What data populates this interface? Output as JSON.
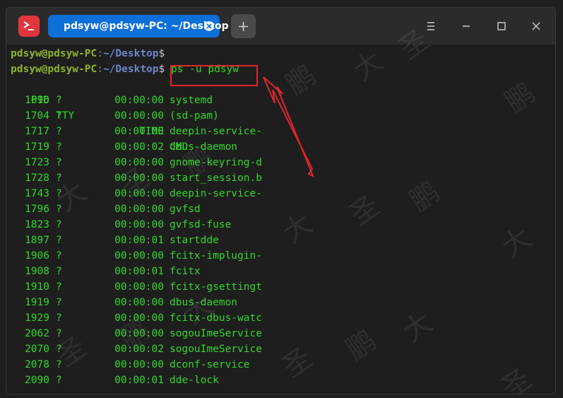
{
  "window": {
    "tab_title": "pdsyw@pdsyw-PC: ~/Desktop",
    "icons": {
      "app": "terminal-icon",
      "tab_close": "close-icon",
      "add_tab": "plus-icon",
      "menu": "hamburger-menu-icon",
      "minimize": "minimize-icon",
      "maximize": "maximize-icon",
      "close": "close-icon"
    }
  },
  "terminal": {
    "prompt_user": "pdsyw@pdsyw-PC",
    "prompt_sep": ":",
    "prompt_path": "~/Desktop",
    "prompt_dollar": "$",
    "command": "ps -u pdsyw",
    "header": {
      "pid": "PID",
      "tty": "TTY",
      "time": "TIME",
      "cmd": "CMD"
    },
    "rows": [
      {
        "pid": "1696",
        "tty": "?",
        "time": "00:00:00",
        "cmd": "systemd"
      },
      {
        "pid": "1704",
        "tty": "?",
        "time": "00:00:00",
        "cmd": "(sd-pam)"
      },
      {
        "pid": "1717",
        "tty": "?",
        "time": "00:00:00",
        "cmd": "deepin-service-"
      },
      {
        "pid": "1719",
        "tty": "?",
        "time": "00:00:02",
        "cmd": "dbus-daemon"
      },
      {
        "pid": "1723",
        "tty": "?",
        "time": "00:00:00",
        "cmd": "gnome-keyring-d"
      },
      {
        "pid": "1728",
        "tty": "?",
        "time": "00:00:00",
        "cmd": "start_session.b"
      },
      {
        "pid": "1743",
        "tty": "?",
        "time": "00:00:00",
        "cmd": "deepin-service-"
      },
      {
        "pid": "1796",
        "tty": "?",
        "time": "00:00:00",
        "cmd": "gvfsd"
      },
      {
        "pid": "1823",
        "tty": "?",
        "time": "00:00:00",
        "cmd": "gvfsd-fuse"
      },
      {
        "pid": "1897",
        "tty": "?",
        "time": "00:00:01",
        "cmd": "startdde"
      },
      {
        "pid": "1906",
        "tty": "?",
        "time": "00:00:00",
        "cmd": "fcitx-implugin-"
      },
      {
        "pid": "1908",
        "tty": "?",
        "time": "00:00:01",
        "cmd": "fcitx"
      },
      {
        "pid": "1910",
        "tty": "?",
        "time": "00:00:00",
        "cmd": "fcitx-gsettingt"
      },
      {
        "pid": "1919",
        "tty": "?",
        "time": "00:00:00",
        "cmd": "dbus-daemon"
      },
      {
        "pid": "1929",
        "tty": "?",
        "time": "00:00:00",
        "cmd": "fcitx-dbus-watc"
      },
      {
        "pid": "2062",
        "tty": "?",
        "time": "00:00:00",
        "cmd": "sogouImeService"
      },
      {
        "pid": "2070",
        "tty": "?",
        "time": "00:00:02",
        "cmd": "sogouImeService"
      },
      {
        "pid": "2078",
        "tty": "?",
        "time": "00:00:00",
        "cmd": "dconf-service"
      },
      {
        "pid": "2090",
        "tty": "?",
        "time": "00:00:01",
        "cmd": "dde-lock"
      }
    ]
  },
  "colors": {
    "highlight": "#e0262b",
    "tab_active": "#0d6fd8",
    "output_green": "#33d62c"
  },
  "watermark": [
    "鹏",
    "大",
    "圣"
  ]
}
